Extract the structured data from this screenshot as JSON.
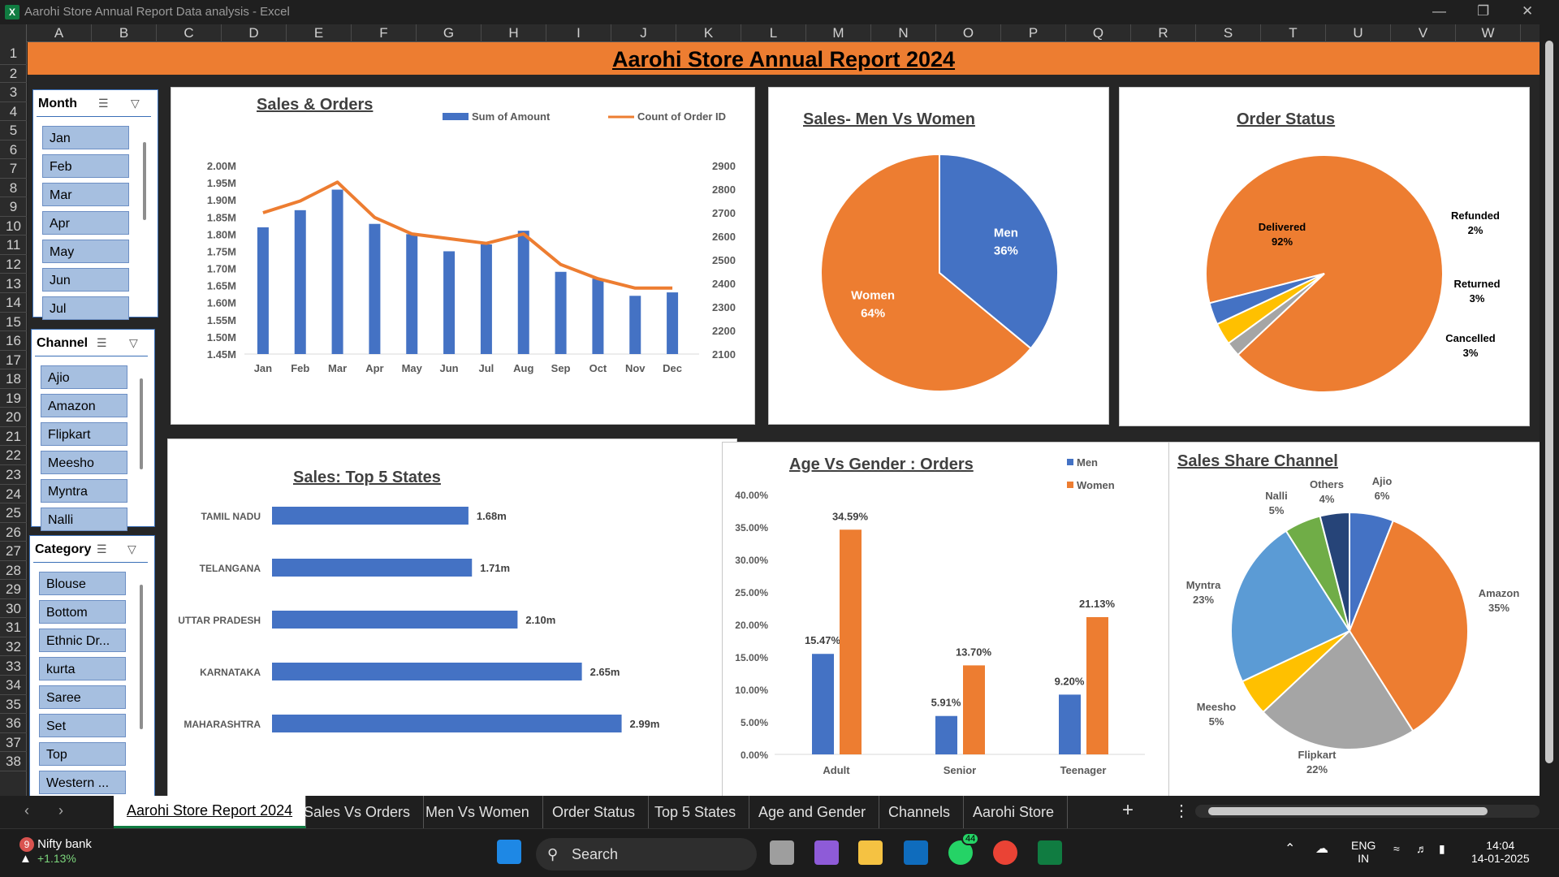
{
  "window": {
    "title": "Aarohi Store Annual Report Data analysis - Excel",
    "app_icon": "X"
  },
  "columns": [
    "A",
    "B",
    "C",
    "D",
    "E",
    "F",
    "G",
    "H",
    "I",
    "J",
    "K",
    "L",
    "M",
    "N",
    "O",
    "P",
    "Q",
    "R",
    "S",
    "T",
    "U",
    "V",
    "W"
  ],
  "rows": [
    "1",
    "2",
    "3",
    "4",
    "5",
    "6",
    "7",
    "8",
    "9",
    "10",
    "11",
    "12",
    "13",
    "14",
    "15",
    "16",
    "17",
    "18",
    "19",
    "20",
    "21",
    "22",
    "23",
    "24",
    "25",
    "26",
    "27",
    "28",
    "29",
    "30",
    "31",
    "32",
    "33",
    "34",
    "35",
    "36",
    "37",
    "38"
  ],
  "banner": {
    "title": "Aarohi Store Annual Report 2024",
    "color": "#ed7d31"
  },
  "slicers": {
    "month": {
      "title": "Month",
      "items": [
        "Jan",
        "Feb",
        "Mar",
        "Apr",
        "May",
        "Jun",
        "Jul"
      ]
    },
    "channel": {
      "title": "Channel",
      "items": [
        "Ajio",
        "Amazon",
        "Flipkart",
        "Meesho",
        "Myntra",
        "Nalli"
      ]
    },
    "category": {
      "title": "Category",
      "items": [
        "Blouse",
        "Bottom",
        "Ethnic Dr...",
        "kurta",
        "Saree",
        "Set",
        "Top",
        "Western ..."
      ]
    }
  },
  "chart_data": [
    {
      "type": "bar",
      "title": "Sales & Orders",
      "categories": [
        "Jan",
        "Feb",
        "Mar",
        "Apr",
        "May",
        "Jun",
        "Jul",
        "Aug",
        "Sep",
        "Oct",
        "Nov",
        "Dec"
      ],
      "series": [
        {
          "name": "Sum of Amount",
          "kind": "bar",
          "axis": "left",
          "color": "#4472c4",
          "values": [
            1.82,
            1.87,
            1.93,
            1.83,
            1.8,
            1.75,
            1.77,
            1.81,
            1.69,
            1.67,
            1.62,
            1.63
          ]
        },
        {
          "name": "Count of Order ID",
          "kind": "line",
          "axis": "right",
          "color": "#ed7d31",
          "values": [
            2700,
            2750,
            2830,
            2680,
            2610,
            2590,
            2570,
            2610,
            2480,
            2420,
            2380,
            2380
          ]
        }
      ],
      "ylim": [
        1.45,
        2.0
      ],
      "y2lim": [
        2100,
        2900
      ],
      "yticks": [
        "2.00M",
        "1.95M",
        "1.90M",
        "1.85M",
        "1.80M",
        "1.75M",
        "1.70M",
        "1.65M",
        "1.60M",
        "1.55M",
        "1.50M",
        "1.45M"
      ],
      "y2ticks": [
        "2900",
        "2800",
        "2700",
        "2600",
        "2500",
        "2400",
        "2300",
        "2200",
        "2100"
      ],
      "legend": "top"
    },
    {
      "type": "pie",
      "title": "Sales- Men Vs Women",
      "slices": [
        {
          "label": "Men",
          "value": 36,
          "display": "36%",
          "color": "#4472c4"
        },
        {
          "label": "Women",
          "value": 64,
          "display": "64%",
          "color": "#ed7d31"
        }
      ]
    },
    {
      "type": "pie",
      "title": "Order Status",
      "slices": [
        {
          "label": "Delivered",
          "value": 92,
          "display": "92%",
          "color": "#ed7d31"
        },
        {
          "label": "Refunded",
          "value": 2,
          "display": "2%",
          "color": "#a5a5a5"
        },
        {
          "label": "Returned",
          "value": 3,
          "display": "3%",
          "color": "#ffc000"
        },
        {
          "label": "Cancelled",
          "value": 3,
          "display": "3%",
          "color": "#4472c4"
        }
      ]
    },
    {
      "type": "bar",
      "orientation": "horizontal",
      "title": "Sales: Top 5 States",
      "categories": [
        "TAMIL NADU",
        "TELANGANA",
        "UTTAR PRADESH",
        "KARNATAKA",
        "MAHARASHTRA"
      ],
      "values": [
        1.68,
        1.71,
        2.1,
        2.65,
        2.99
      ],
      "labels": [
        "1.68m",
        "1.71m",
        "2.10m",
        "2.65m",
        "2.99m"
      ],
      "xlim": [
        0,
        3.5
      ],
      "xticks": [
        "0.0M",
        "0.5M",
        "1.0M",
        "1.5M",
        "2.0M",
        "2.5M",
        "3.0M",
        "3.5M"
      ],
      "color": "#4472c4"
    },
    {
      "type": "bar",
      "title": "Age Vs Gender : Orders",
      "categories": [
        "Adult",
        "Senior",
        "Teenager"
      ],
      "series": [
        {
          "name": "Men",
          "values": [
            15.47,
            5.91,
            9.2
          ],
          "labels": [
            "15.47%",
            "5.91%",
            "9.20%"
          ],
          "color": "#4472c4"
        },
        {
          "name": "Women",
          "values": [
            34.59,
            13.7,
            21.13
          ],
          "labels": [
            "34.59%",
            "13.70%",
            "21.13%"
          ],
          "color": "#ed7d31"
        }
      ],
      "ylim": [
        0,
        40
      ],
      "yticks": [
        "40.00%",
        "35.00%",
        "30.00%",
        "25.00%",
        "20.00%",
        "15.00%",
        "10.00%",
        "5.00%",
        "0.00%"
      ],
      "legend": "top-right"
    },
    {
      "type": "pie",
      "title": "Sales Share Channel",
      "slices": [
        {
          "label": "Ajio",
          "value": 6,
          "display": "6%",
          "color": "#4472c4"
        },
        {
          "label": "Amazon",
          "value": 35,
          "display": "35%",
          "color": "#ed7d31"
        },
        {
          "label": "Flipkart",
          "value": 22,
          "display": "22%",
          "color": "#a5a5a5"
        },
        {
          "label": "Meesho",
          "value": 5,
          "display": "5%",
          "color": "#ffc000"
        },
        {
          "label": "Myntra",
          "value": 23,
          "display": "23%",
          "color": "#5b9bd5"
        },
        {
          "label": "Nalli",
          "value": 5,
          "display": "5%",
          "color": "#70ad47"
        },
        {
          "label": "Others",
          "value": 4,
          "display": "4%",
          "color": "#264478"
        }
      ]
    }
  ],
  "sheet_tabs": [
    "Aarohi Store Report 2024",
    "Sales Vs Orders",
    "Men Vs Women",
    "Order Status",
    "Top 5 States",
    "Age and Gender",
    "Channels",
    "Aarohi Store"
  ],
  "active_tab": "Aarohi Store Report 2024",
  "taskbar": {
    "widget_badge": "9",
    "widget_name": "Nifty bank",
    "widget_change": "+1.13%",
    "search_label": "Search",
    "whatsapp_badge": "44",
    "lang": "ENG",
    "region": "IN",
    "time": "14:04",
    "date": "14-01-2025"
  }
}
